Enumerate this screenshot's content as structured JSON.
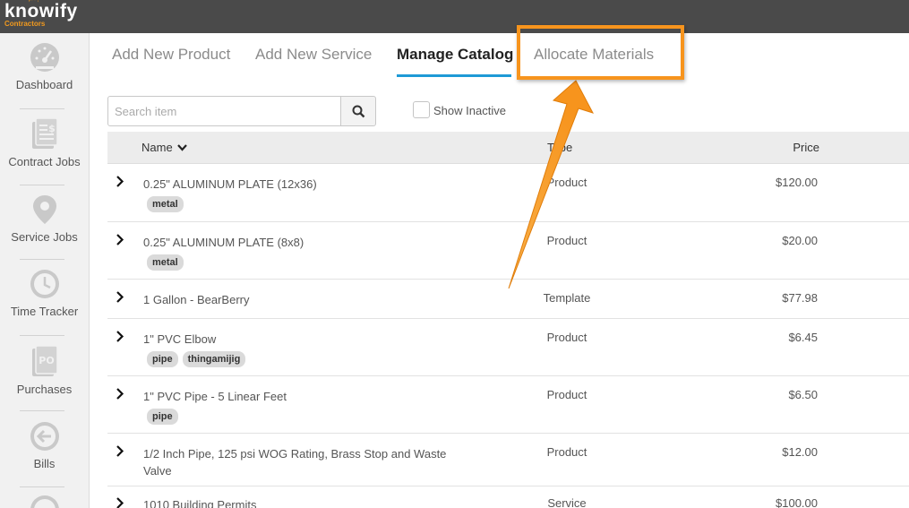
{
  "app": {
    "logo_text_pre": "kn",
    "logo_text_o": "o",
    "logo_text_post": "wify",
    "logo_subtitle": "Contractors"
  },
  "sidebar": {
    "items": [
      {
        "label": "Dashboard",
        "icon": "gauge-icon"
      },
      {
        "label": "Contract Jobs",
        "icon": "document-dollar-icon"
      },
      {
        "label": "Service Jobs",
        "icon": "map-pin-icon"
      },
      {
        "label": "Time Tracker",
        "icon": "clock-icon"
      },
      {
        "label": "Purchases",
        "icon": "po-icon"
      },
      {
        "label": "Bills",
        "icon": "arrow-left-circle-icon"
      }
    ]
  },
  "tabs": [
    {
      "label": "Add New Product"
    },
    {
      "label": "Add New Service"
    },
    {
      "label": "Manage Catalog"
    },
    {
      "label": "Allocate Materials"
    }
  ],
  "search": {
    "placeholder": "Search item",
    "value": ""
  },
  "filter": {
    "show_inactive_label": "Show Inactive",
    "show_inactive_checked": false
  },
  "table": {
    "columns": {
      "name": "Name",
      "type": "Type",
      "price": "Price"
    },
    "rows": [
      {
        "name": "0.25\" ALUMINUM PLATE (12x36)",
        "type": "Product",
        "price": "$120.00",
        "tags": [
          "metal"
        ]
      },
      {
        "name": "0.25\" ALUMINUM PLATE (8x8)",
        "type": "Product",
        "price": "$20.00",
        "tags": [
          "metal"
        ]
      },
      {
        "name": "1 Gallon - BearBerry",
        "type": "Template",
        "price": "$77.98",
        "tags": []
      },
      {
        "name": "1\" PVC Elbow",
        "type": "Product",
        "price": "$6.45",
        "tags": [
          "pipe",
          "thingamijig"
        ]
      },
      {
        "name": "1\" PVC Pipe - 5 Linear Feet",
        "type": "Product",
        "price": "$6.50",
        "tags": [
          "pipe"
        ]
      },
      {
        "name": "1/2 Inch Pipe, 125 psi WOG Rating, Brass Stop and Waste Valve",
        "type": "Product",
        "price": "$12.00",
        "tags": []
      },
      {
        "name": "1010 Building Permits",
        "type": "Service",
        "price": "$100.00",
        "tags": []
      }
    ]
  },
  "colors": {
    "accent": "#f7941d",
    "tab_underline": "#1e9ad6",
    "topbar": "#4a4a4a"
  }
}
